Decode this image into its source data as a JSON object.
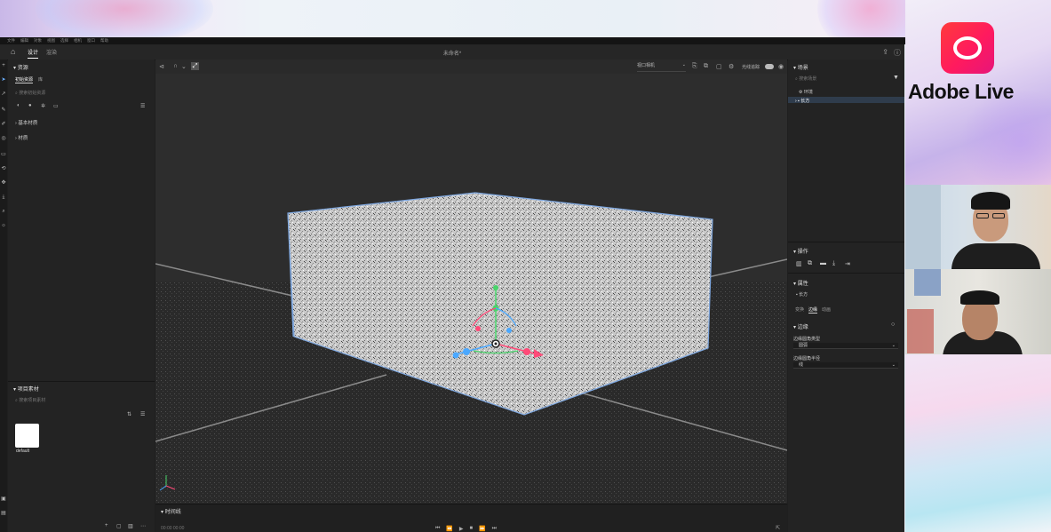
{
  "menu": [
    "文件",
    "编辑",
    "对象",
    "视图",
    "选择",
    "相机",
    "窗口",
    "帮助"
  ],
  "topbar": {
    "tabs": [
      "设计",
      "渲染"
    ],
    "doc_title": "未命名*"
  },
  "left_panel": {
    "assets_title": "资源",
    "subtabs": [
      "初始资源",
      "库"
    ],
    "search_placeholder": "搜索初始资源",
    "tree": [
      "基本材质",
      "材质"
    ],
    "project_title": "项目素材",
    "project_search_placeholder": "搜索项目素材",
    "asset_name": "default"
  },
  "viewport": {
    "camera": "视口相机",
    "preview_label": "光线追踪"
  },
  "timeline": {
    "title": "时间线",
    "timecode": "00:00  00:00"
  },
  "right_panel": {
    "scene_title": "场景",
    "search_placeholder": "搜索场景",
    "scene_items": [
      "环境",
      "长方"
    ],
    "actions_title": "操作",
    "properties_title": "属性",
    "selected_object": "长方",
    "prop_tabs": [
      "变换",
      "边缘",
      "动画"
    ],
    "edge_title": "边缘",
    "edge_type_label": "边缘圆角类型",
    "edge_type_value": "圆弧",
    "edge_size_label": "边缘圆角半径",
    "edge_size_value": "线"
  },
  "stream": {
    "brand": "Adobe Live"
  }
}
